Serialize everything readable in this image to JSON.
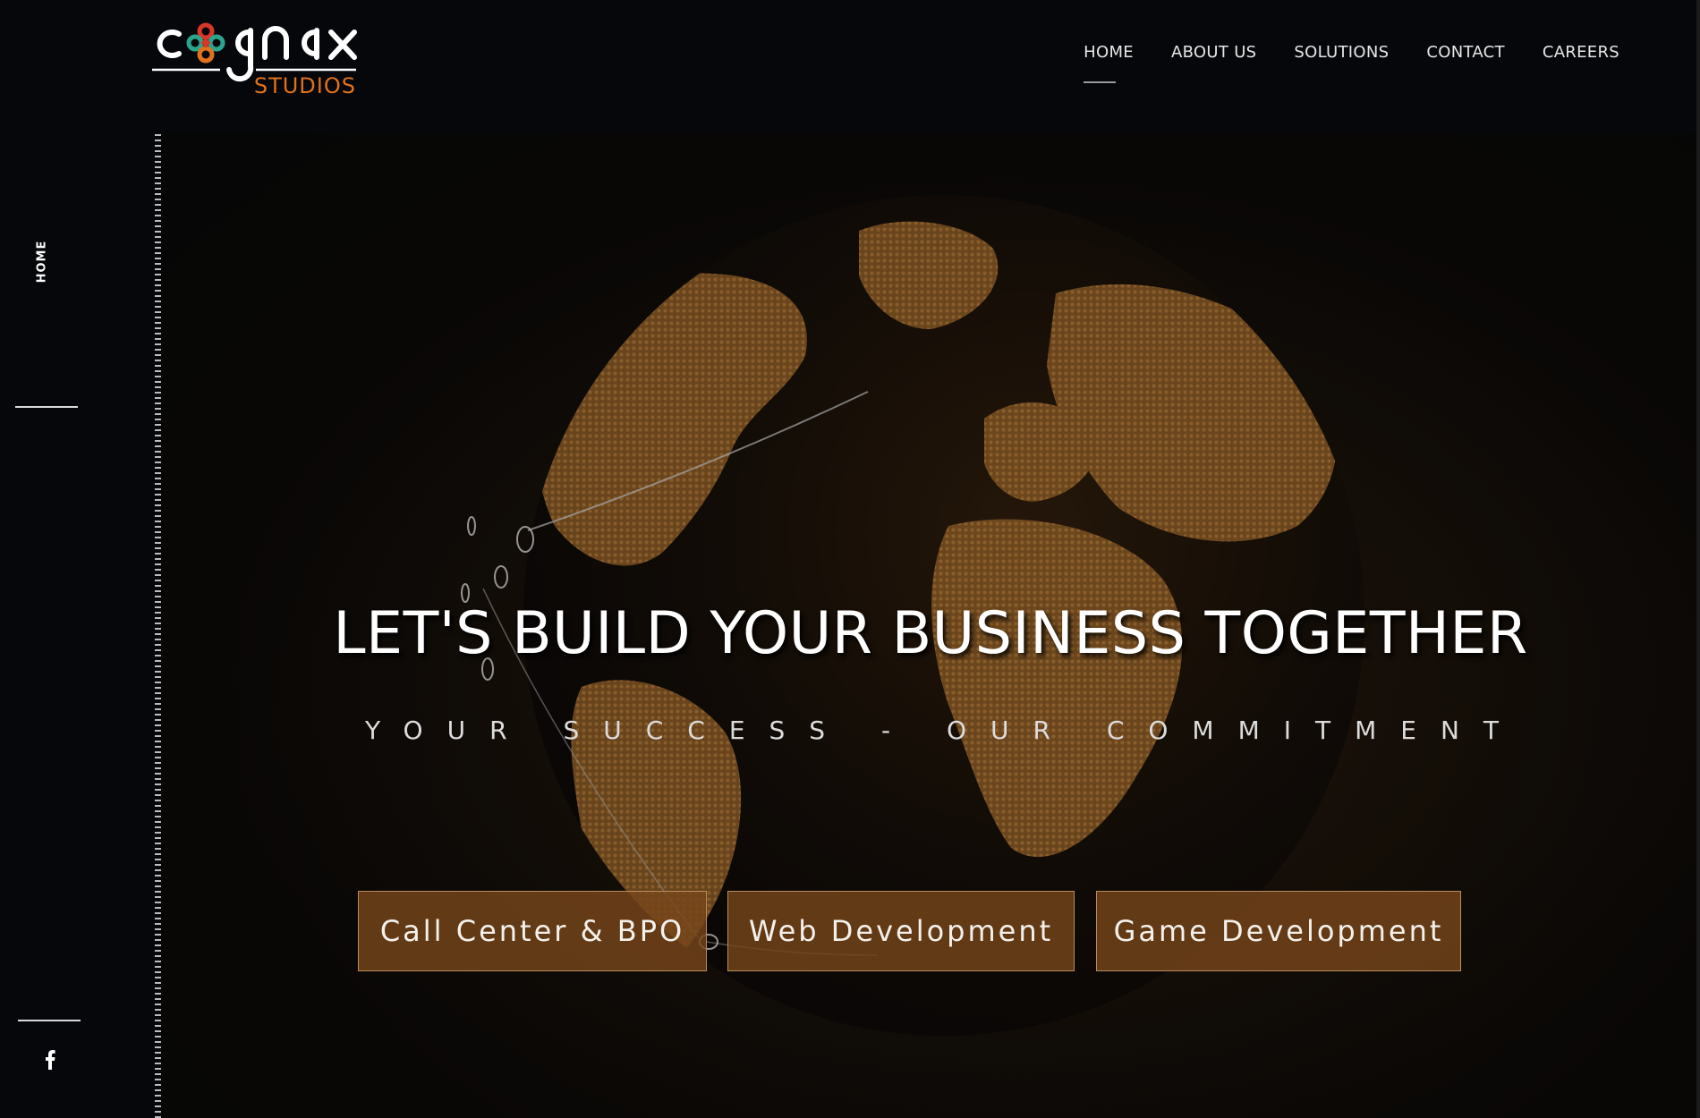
{
  "brand": {
    "logo_text": "cognax",
    "logo_sub": "STUDIOS",
    "accent": "#e0711d"
  },
  "nav": {
    "items": [
      {
        "label": "HOME",
        "active": true
      },
      {
        "label": "ABOUT US",
        "active": false
      },
      {
        "label": "SOLUTIONS",
        "active": false
      },
      {
        "label": "CONTACT",
        "active": false
      },
      {
        "label": "CAREERS",
        "active": false
      }
    ]
  },
  "sidebar": {
    "section_label": "HOME",
    "social_icon": "facebook-icon"
  },
  "hero": {
    "title": "LET'S BUILD YOUR BUSINESS TOGETHER",
    "subtitle": "YOUR SUCCESS - OUR COMMITMENT",
    "buttons": [
      {
        "label": "Call Center & BPO"
      },
      {
        "label": "Web Development"
      },
      {
        "label": "Game Development"
      }
    ]
  }
}
